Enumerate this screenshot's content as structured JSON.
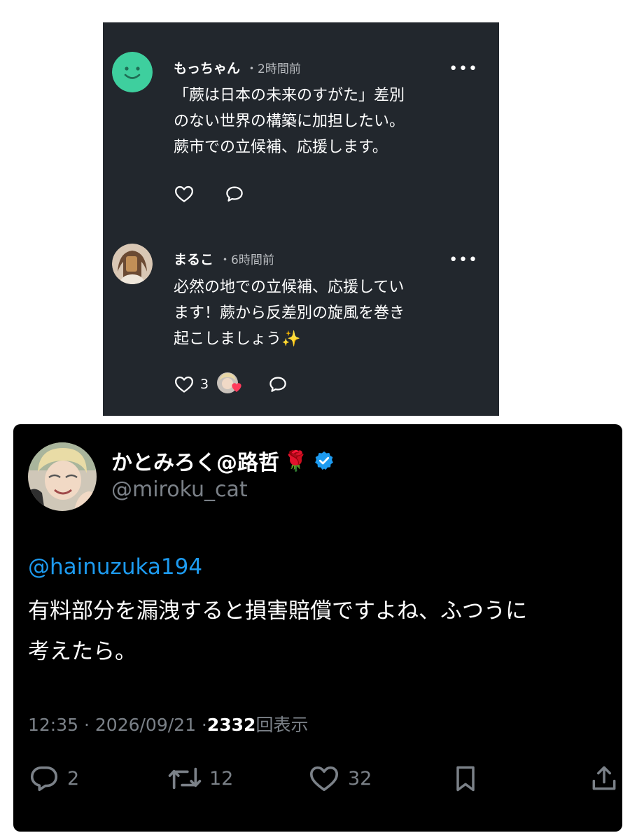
{
  "comments": [
    {
      "name": "もっちゃん",
      "meta": "・2時間前",
      "more": "•••",
      "lines": [
        "「蕨は日本の未来のすがた」差別",
        "のない世界の構築に加担したい。",
        "蕨市での立候補、応援します。"
      ],
      "avatar_color": "#3ecf9e",
      "avatar_icon": "smiley-icon"
    },
    {
      "name": "まるこ",
      "meta": "・6時間前",
      "more": "•••",
      "lines": [
        "必然の地での立候補、応援してい",
        "ます！蕨から反差別の旋風を巻き",
        "起こしましょう✨"
      ],
      "like_count": "3",
      "avatar_icon": "user-photo"
    }
  ],
  "tweet": {
    "name": "かとみろく@路哲",
    "name_emoji": "🌹",
    "verified": true,
    "handle": "@miroku_cat",
    "mention": "@hainuzuka194",
    "lines": [
      "有料部分を漏洩すると損害賠償ですよね、ふつうに",
      "考えたら。"
    ],
    "time": "12:35 · 2026/09/21 · ",
    "views_count": "2332",
    "views_label": " 回表示",
    "replies": "2",
    "retweets": "12",
    "likes": "32",
    "colors": {
      "link": "#1d9bf0",
      "muted": "#7b8188",
      "verified": "#1d9bf0"
    }
  }
}
